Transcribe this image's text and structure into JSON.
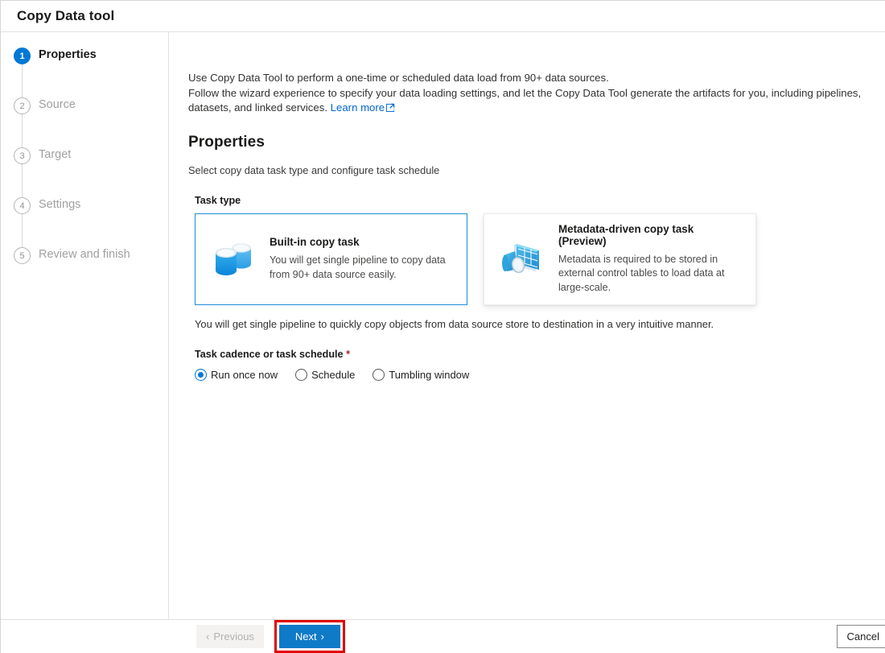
{
  "window": {
    "title": "Copy Data tool"
  },
  "sidebar": {
    "steps": [
      {
        "number": "1",
        "label": "Properties",
        "state": "active"
      },
      {
        "number": "2",
        "label": "Source",
        "state": "idle"
      },
      {
        "number": "3",
        "label": "Target",
        "state": "idle"
      },
      {
        "number": "4",
        "label": "Settings",
        "state": "idle"
      },
      {
        "number": "5",
        "label": "Review and finish",
        "state": "idle"
      }
    ]
  },
  "main": {
    "intro_line1": "Use Copy Data Tool to perform a one-time or scheduled data load from 90+ data sources.",
    "intro_line2": "Follow the wizard experience to specify your data loading settings, and let the Copy Data Tool generate the artifacts for you, including pipelines, datasets, and linked services.",
    "learn_more": "Learn more",
    "heading": "Properties",
    "subheading": "Select copy data task type and configure task schedule",
    "task_type_label": "Task type",
    "cards": [
      {
        "title": "Built-in copy task",
        "desc": "You will get single pipeline to copy data from 90+ data source easily.",
        "icon": "database-cylinders-icon",
        "selected": true
      },
      {
        "title": "Metadata-driven copy task (Preview)",
        "desc": "Metadata is required to be stored in external control tables to load data at large-scale.",
        "icon": "metadata-table-magnifier-icon",
        "selected": false
      }
    ],
    "note": "You will get single pipeline to quickly copy objects from data source store to destination in a very intuitive manner.",
    "cadence_label": "Task cadence or task schedule",
    "cadence_required_mark": "*",
    "cadence_options": [
      {
        "label": "Run once now",
        "checked": true
      },
      {
        "label": "Schedule",
        "checked": false
      },
      {
        "label": "Tumbling window",
        "checked": false
      }
    ]
  },
  "footer": {
    "previous_label": "Previous",
    "previous_chevron": "‹",
    "next_label": "Next",
    "next_chevron": "›",
    "cancel_label": "Cancel"
  },
  "colors": {
    "accent": "#0078d4",
    "next_button": "#0f7ac8",
    "highlight_annotation": "#e00000",
    "link": "#0066cc",
    "required_star": "#a4262c"
  }
}
